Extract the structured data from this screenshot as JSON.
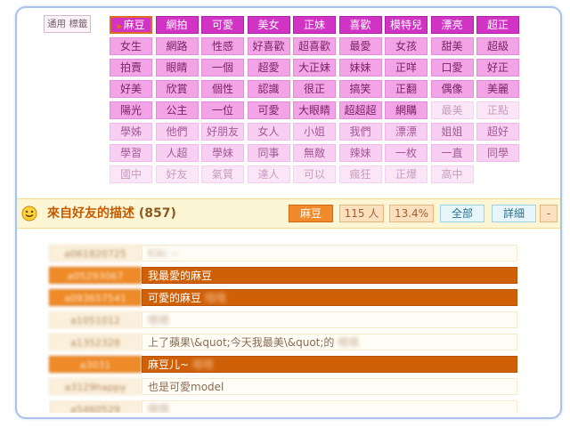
{
  "tags_section": {
    "label": "通用 標籤",
    "tags": [
      {
        "text": "麻豆",
        "tier": 1,
        "selected": true
      },
      {
        "text": "網拍",
        "tier": 1
      },
      {
        "text": "可愛",
        "tier": 1
      },
      {
        "text": "美女",
        "tier": 1
      },
      {
        "text": "正妹",
        "tier": 1
      },
      {
        "text": "喜歡",
        "tier": 1
      },
      {
        "text": "模特兒",
        "tier": 1
      },
      {
        "text": "漂亮",
        "tier": 1
      },
      {
        "text": "超正",
        "tier": 1
      },
      {
        "text": "女生",
        "tier": 2
      },
      {
        "text": "網路",
        "tier": 2
      },
      {
        "text": "性感",
        "tier": 2
      },
      {
        "text": "好喜歡",
        "tier": 2
      },
      {
        "text": "超喜歡",
        "tier": 2
      },
      {
        "text": "最愛",
        "tier": 2
      },
      {
        "text": "女孩",
        "tier": 2
      },
      {
        "text": "甜美",
        "tier": 2
      },
      {
        "text": "超級",
        "tier": 2
      },
      {
        "text": "拍賣",
        "tier": 2
      },
      {
        "text": "眼睛",
        "tier": 2
      },
      {
        "text": "一個",
        "tier": 2
      },
      {
        "text": "超愛",
        "tier": 2
      },
      {
        "text": "大正妹",
        "tier": 2
      },
      {
        "text": "妹妹",
        "tier": 2
      },
      {
        "text": "正咩",
        "tier": 2
      },
      {
        "text": "口愛",
        "tier": 2
      },
      {
        "text": "好正",
        "tier": 2
      },
      {
        "text": "好美",
        "tier": 2
      },
      {
        "text": "欣賞",
        "tier": 2
      },
      {
        "text": "個性",
        "tier": 2
      },
      {
        "text": "認識",
        "tier": 2
      },
      {
        "text": "很正",
        "tier": 2
      },
      {
        "text": "搞笑",
        "tier": 2
      },
      {
        "text": "正翻",
        "tier": 2
      },
      {
        "text": "偶像",
        "tier": 2
      },
      {
        "text": "美麗",
        "tier": 2
      },
      {
        "text": "陽光",
        "tier": 2
      },
      {
        "text": "公主",
        "tier": 2
      },
      {
        "text": "一位",
        "tier": 2
      },
      {
        "text": "可愛",
        "tier": 2
      },
      {
        "text": "大眼睛",
        "tier": 2
      },
      {
        "text": "超超超",
        "tier": 2
      },
      {
        "text": "網購",
        "tier": 2
      },
      {
        "text": "最美",
        "tier": 4
      },
      {
        "text": "正點",
        "tier": 4
      },
      {
        "text": "學姊",
        "tier": 3
      },
      {
        "text": "他們",
        "tier": 3
      },
      {
        "text": "好朋友",
        "tier": 3
      },
      {
        "text": "女人",
        "tier": 3
      },
      {
        "text": "小姐",
        "tier": 3
      },
      {
        "text": "我們",
        "tier": 3
      },
      {
        "text": "漂漂",
        "tier": 3
      },
      {
        "text": "姐姐",
        "tier": 3
      },
      {
        "text": "超好",
        "tier": 3
      },
      {
        "text": "學習",
        "tier": 3
      },
      {
        "text": "人超",
        "tier": 3
      },
      {
        "text": "學妹",
        "tier": 3
      },
      {
        "text": "同事",
        "tier": 3
      },
      {
        "text": "無敵",
        "tier": 3
      },
      {
        "text": "辣妹",
        "tier": 3
      },
      {
        "text": "一枚",
        "tier": 3
      },
      {
        "text": "一直",
        "tier": 3
      },
      {
        "text": "同學",
        "tier": 3
      },
      {
        "text": "國中",
        "tier": 4
      },
      {
        "text": "好友",
        "tier": 4
      },
      {
        "text": "氣質",
        "tier": 4
      },
      {
        "text": "達人",
        "tier": 4
      },
      {
        "text": "可以",
        "tier": 4
      },
      {
        "text": "瘋狂",
        "tier": 4
      },
      {
        "text": "正爆",
        "tier": 4
      },
      {
        "text": "高中",
        "tier": 4
      }
    ]
  },
  "description_bar": {
    "title": "來自好友的描述",
    "count": "(857)",
    "tag_button": "麻豆",
    "people_button": "115 人",
    "percent_button": "13.4%",
    "all_button": "全部",
    "detail_button": "詳細",
    "more_button": "-",
    "colors": {
      "title": "#c75a00",
      "accent": "#f08a2a"
    }
  },
  "descriptions": [
    {
      "user": "a061820725",
      "text": "",
      "blurred": "Kiki ~",
      "highlight": false
    },
    {
      "user": "a05293067",
      "text": "我最愛的麻豆",
      "blurred": "",
      "highlight": true
    },
    {
      "user": "a093657541",
      "text": "可愛的麻豆",
      "blurred": "哦哦",
      "highlight": true
    },
    {
      "user": "a1051012",
      "text": "",
      "blurred": "嗯嗯",
      "highlight": false
    },
    {
      "user": "a1352328",
      "text": "上了蘋果\\&quot;今天我最美\\&quot;的",
      "blurred": "嗯嗯",
      "highlight": false
    },
    {
      "user": "a3031",
      "text": "麻豆儿~",
      "blurred": "嗯嗯",
      "highlight": true
    },
    {
      "user": "a3129happy",
      "text": "也是可愛model",
      "blurred": "",
      "highlight": false
    },
    {
      "user": "a5460529",
      "text": "",
      "blurred": "嗯嗯",
      "highlight": false
    }
  ]
}
